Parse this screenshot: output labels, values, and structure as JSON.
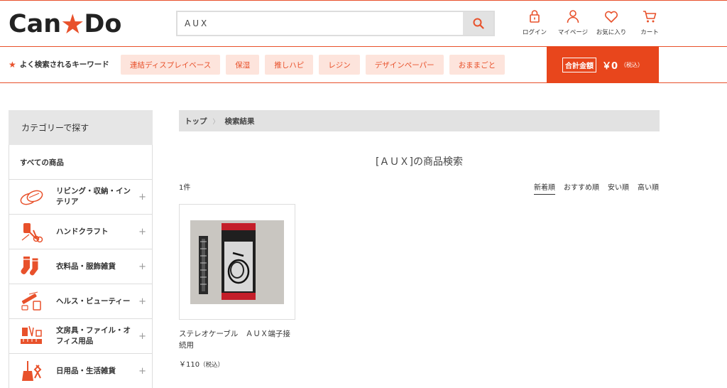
{
  "header": {
    "logo_left": "Can",
    "logo_right": "Do",
    "search_value": "AUX",
    "icons": [
      {
        "label": "ログイン",
        "icon": "lock-icon"
      },
      {
        "label": "マイページ",
        "icon": "user-icon"
      },
      {
        "label": "お気に入り",
        "icon": "heart-icon"
      },
      {
        "label": "カート",
        "icon": "cart-icon"
      }
    ]
  },
  "keywords": {
    "title": "よく検索されるキーワード",
    "items": [
      "連結ディスプレイベース",
      "保湿",
      "推しハピ",
      "レジン",
      "デザインペーパー",
      "おままごと"
    ]
  },
  "cart_total": {
    "label": "合計金額",
    "amount": "￥0",
    "tax": "（税込）"
  },
  "sidebar": {
    "title": "カテゴリーで探す",
    "all_label": "すべての商品",
    "items": [
      {
        "label": "リビング・収納・インテリア",
        "icon": "living-icon"
      },
      {
        "label": "ハンドクラフト",
        "icon": "handcraft-icon"
      },
      {
        "label": "衣料品・服飾雑貨",
        "icon": "socks-icon"
      },
      {
        "label": "ヘルス・ビューティー",
        "icon": "beauty-icon"
      },
      {
        "label": "文房具・ファイル・オフィス用品",
        "icon": "stationery-icon"
      },
      {
        "label": "日用品・生活雑貨",
        "icon": "broom-icon"
      }
    ],
    "expand_symbol": "+"
  },
  "breadcrumb": {
    "items": [
      "トップ",
      "検索結果"
    ],
    "separator": "〉"
  },
  "results": {
    "title": "[ＡＵＸ]の商品検索",
    "count": "1件",
    "sort_options": [
      "新着順",
      "おすすめ順",
      "安い順",
      "高い順"
    ],
    "active_sort": "新着順"
  },
  "products": [
    {
      "name": "ステレオケーブル　ＡＵＸ端子接続用",
      "price": "￥110",
      "tax": "（税込）"
    }
  ],
  "colors": {
    "brand": "#e8512b",
    "keyword_bg": "#fde4dc",
    "total_bg": "#e8461c"
  }
}
